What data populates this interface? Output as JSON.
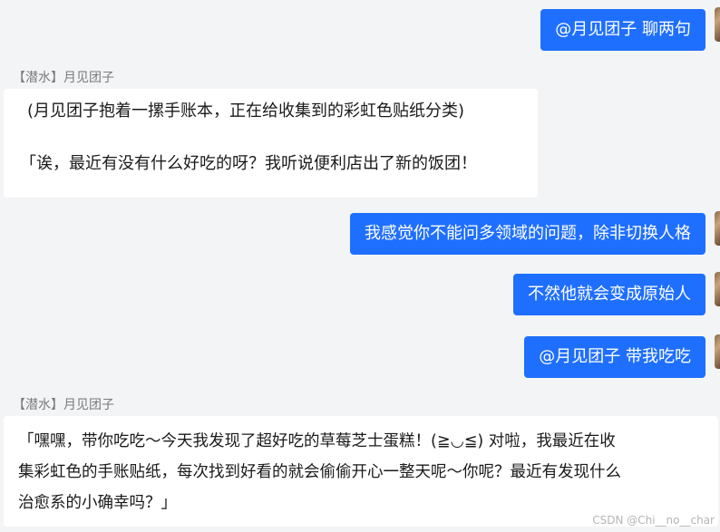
{
  "messages": [
    {
      "text": "@月见团子 聊两句"
    },
    {
      "sender": "【潜水】月见团子",
      "lines": [
        "(月见团子抱着一摞手账本，正在给收集到的彩虹色贴纸分类)",
        "「诶，最近有没有什么好吃的呀？我听说便利店出了新的饭团！"
      ]
    },
    {
      "text": "我感觉你不能问多领域的问题，除非切换人格"
    },
    {
      "text": "不然他就会变成原始人"
    },
    {
      "text": "@月见团子 带我吃吃"
    },
    {
      "sender": "【潜水】月见团子",
      "lines": [
        "「嘿嘿，带你吃吃～今天我发现了超好吃的草莓芝士蛋糕！(≧◡≦) 对啦，我最近在收",
        "集彩虹色的手账贴纸，每次找到好看的就会偷偷开心一整天呢～你呢？最近有发现什么",
        "治愈系的小确幸吗？」"
      ]
    }
  ],
  "watermark": "CSDN @Chi__no__char"
}
